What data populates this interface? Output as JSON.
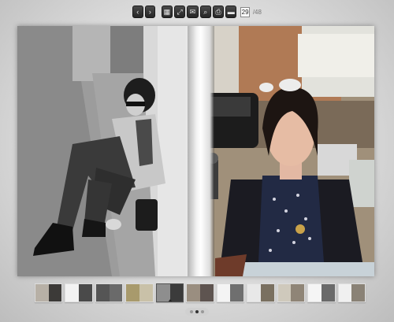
{
  "toolbar": {
    "buttons": [
      {
        "name": "prev-page-button",
        "icon": "chevron-left-icon",
        "glyph": "‹"
      },
      {
        "name": "next-page-button",
        "icon": "chevron-right-icon",
        "glyph": "›"
      },
      {
        "name": "grid-view-button",
        "icon": "grid-icon",
        "glyph": "▦"
      },
      {
        "name": "fullscreen-button",
        "icon": "expand-icon",
        "glyph": "⤢"
      },
      {
        "name": "email-button",
        "icon": "envelope-icon",
        "glyph": "✉"
      },
      {
        "name": "zoom-button",
        "icon": "magnifier-icon",
        "glyph": "⌕"
      },
      {
        "name": "print-button",
        "icon": "printer-icon",
        "glyph": "⎙"
      },
      {
        "name": "folder-button",
        "icon": "folder-icon",
        "glyph": "▬"
      }
    ],
    "current_page": "29",
    "total_pages": "/48"
  },
  "thumbnails": [
    {
      "left": "#b7b0a6",
      "right": "#3c3a38"
    },
    {
      "left": "#f2f2f2",
      "right": "#4a4a4a"
    },
    {
      "left": "#555555",
      "right": "#6a6a6a"
    },
    {
      "left": "#a89a6c",
      "right": "#c9c1a8"
    },
    {
      "left": "#8e8e8e",
      "right": "#3b3b3b",
      "active": true
    },
    {
      "left": "#9a8e80",
      "right": "#5e5450"
    },
    {
      "left": "#f4f4f4",
      "right": "#6f6f6f"
    },
    {
      "left": "#e8e8e8",
      "right": "#7a7060"
    },
    {
      "left": "#cfc9bc",
      "right": "#8f8577"
    },
    {
      "left": "#f5f5f5",
      "right": "#6a6a6a"
    },
    {
      "left": "#f0f0f0",
      "right": "#8a8276"
    }
  ],
  "pager_dots": [
    false,
    true,
    false
  ]
}
